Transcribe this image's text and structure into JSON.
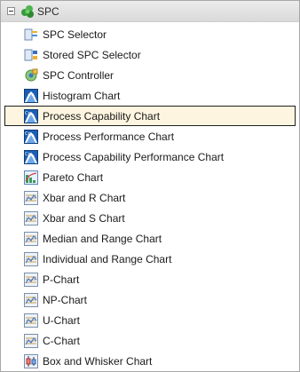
{
  "tree": {
    "root": {
      "label": "SPC",
      "expanded": true
    },
    "items": [
      {
        "label": "SPC Selector",
        "icon": "selector-icon"
      },
      {
        "label": "Stored SPC Selector",
        "icon": "stored-selector-icon"
      },
      {
        "label": "SPC Controller",
        "icon": "controller-icon"
      },
      {
        "label": "Histogram Chart",
        "icon": "histogram-chart-icon"
      },
      {
        "label": "Process Capability Chart",
        "icon": "process-capability-chart-icon",
        "selected": true
      },
      {
        "label": "Process Performance Chart",
        "icon": "process-performance-chart-icon"
      },
      {
        "label": "Process Capability Performance Chart",
        "icon": "process-capability-performance-chart-icon"
      },
      {
        "label": "Pareto Chart",
        "icon": "pareto-chart-icon"
      },
      {
        "label": "Xbar and R Chart",
        "icon": "xbar-r-chart-icon"
      },
      {
        "label": "Xbar and S Chart",
        "icon": "xbar-s-chart-icon"
      },
      {
        "label": "Median and Range Chart",
        "icon": "median-range-chart-icon"
      },
      {
        "label": "Individual and Range Chart",
        "icon": "individual-range-chart-icon"
      },
      {
        "label": "P-Chart",
        "icon": "p-chart-icon"
      },
      {
        "label": "NP-Chart",
        "icon": "np-chart-icon"
      },
      {
        "label": "U-Chart",
        "icon": "u-chart-icon"
      },
      {
        "label": "C-Chart",
        "icon": "c-chart-icon"
      },
      {
        "label": "Box and Whisker Chart",
        "icon": "box-whisker-chart-icon"
      }
    ]
  }
}
